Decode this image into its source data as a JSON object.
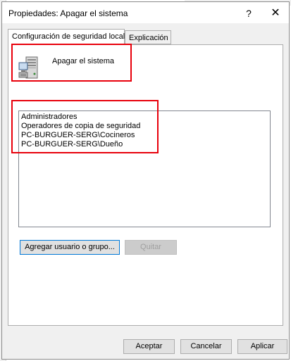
{
  "window": {
    "title": "Propiedades: Apagar el sistema",
    "help_glyph": "?",
    "close_glyph": "✕"
  },
  "tabs": [
    {
      "label": "Configuración de seguridad local",
      "active": true
    },
    {
      "label": "Explicación",
      "active": false
    }
  ],
  "policy": {
    "icon": "server-computer-icon",
    "name": "Apagar el sistema"
  },
  "assigned_users": [
    "Administradores",
    "Operadores de copia de seguridad",
    "PC-BURGUER-SERG\\Cocineros",
    "PC-BURGUER-SERG\\Dueño"
  ],
  "buttons": {
    "add_user": "Agregar usuario o grupo...",
    "remove": "Quitar",
    "ok": "Aceptar",
    "cancel": "Cancelar",
    "apply": "Aplicar"
  },
  "colors": {
    "highlight_box": "#e8000b",
    "focus_border": "#0078d7"
  }
}
